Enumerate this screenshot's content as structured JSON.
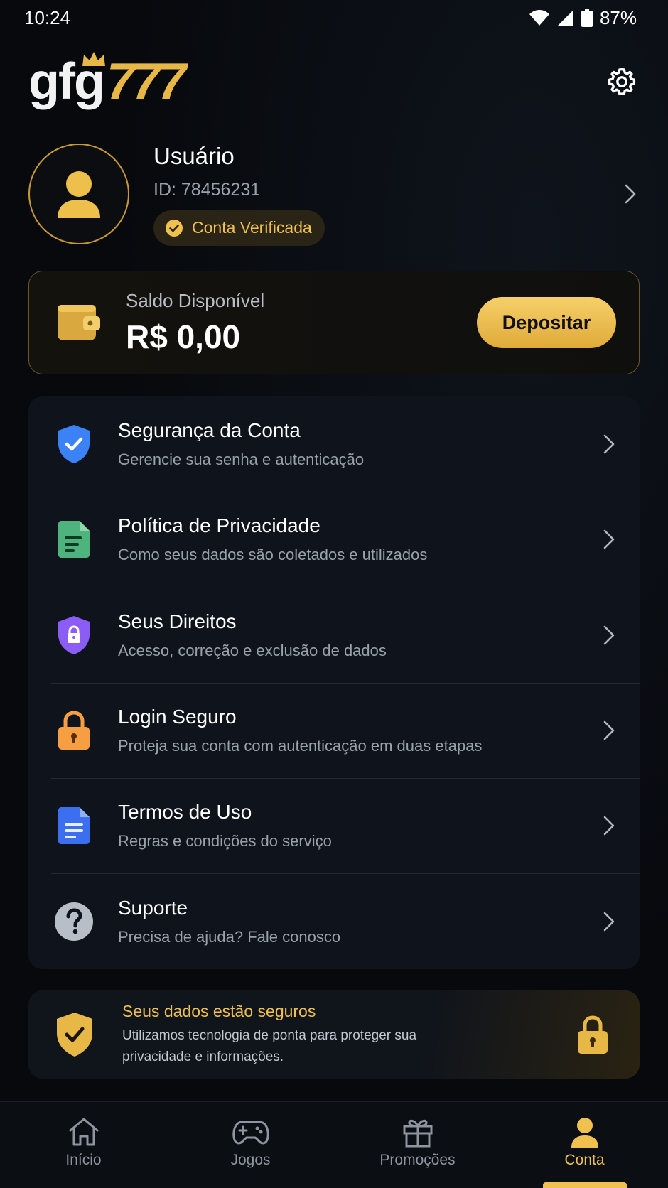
{
  "status_bar": {
    "time": "10:24",
    "battery": "87%"
  },
  "header": {
    "logo_main": "gfg",
    "logo_accent": "777",
    "settings_icon": "gear-icon"
  },
  "profile": {
    "name": "Usuário",
    "id": "ID: 78456231",
    "verified_label": "Conta Verificada"
  },
  "balance": {
    "label": "Saldo Disponível",
    "value": "R$ 0,00",
    "deposit_label": "Depositar"
  },
  "menu": {
    "items": [
      {
        "title": "Segurança da Conta",
        "subtitle": "Gerencie sua senha e autenticação",
        "icon": "shield-check-icon",
        "color": "#3b82f6"
      },
      {
        "title": "Política de Privacidade",
        "subtitle": "Como seus dados são coletados e utilizados",
        "icon": "document-icon",
        "color": "#4fb37e"
      },
      {
        "title": "Seus Direitos",
        "subtitle": "Acesso, correção e exclusão de dados",
        "icon": "shield-lock-icon",
        "color": "#8b5cf6"
      },
      {
        "title": "Login Seguro",
        "subtitle": "Proteja sua conta com autenticação em duas etapas",
        "icon": "lock-icon",
        "color": "#f59e42"
      },
      {
        "title": "Termos de Uso",
        "subtitle": "Regras e condições do serviço",
        "icon": "file-text-icon",
        "color": "#3b6ff0"
      },
      {
        "title": "Suporte",
        "subtitle": "Precisa de ajuda? Fale conosco",
        "icon": "help-icon",
        "color": "#b8bec8"
      }
    ]
  },
  "secure_banner": {
    "title": "Seus dados estão seguros",
    "description": "Utilizamos tecnologia de ponta para proteger sua privacidade e informações."
  },
  "bottom_nav": {
    "items": [
      {
        "label": "Início",
        "icon": "home-icon"
      },
      {
        "label": "Jogos",
        "icon": "gamepad-icon"
      },
      {
        "label": "Promoções",
        "icon": "gift-icon"
      },
      {
        "label": "Conta",
        "icon": "user-icon",
        "active": true
      }
    ]
  },
  "colors": {
    "accent": "#f0c14e",
    "background": "#07090d",
    "card": "#0f141c"
  }
}
